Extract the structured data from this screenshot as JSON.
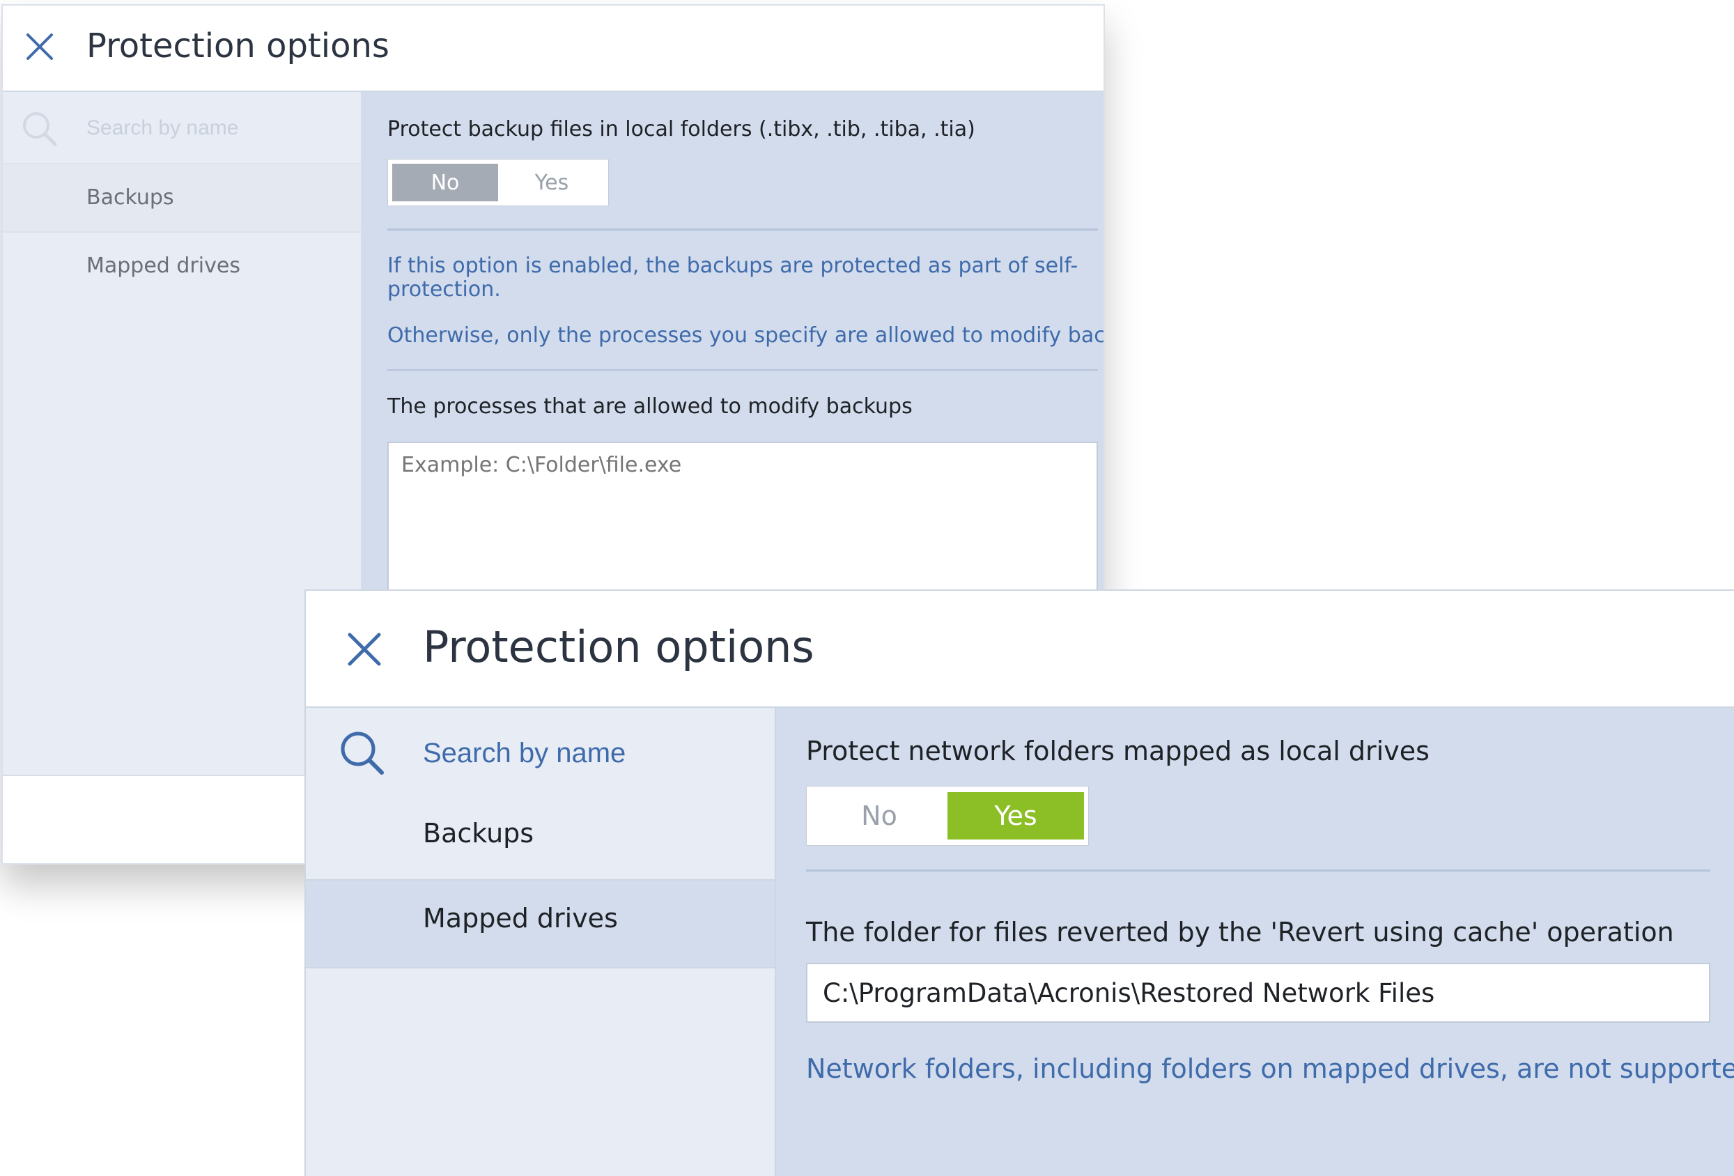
{
  "dialog_back": {
    "title": "Protection options",
    "search": {
      "placeholder": "Search by name"
    },
    "nav": {
      "backups": "Backups",
      "mapped_drives": "Mapped drives"
    },
    "content": {
      "option_label": "Protect backup files in local folders (.tibx, .tib, .tiba, .tia)",
      "toggle": {
        "no": "No",
        "yes": "Yes",
        "selected": "No"
      },
      "info_line1": "If this option is enabled, the backups are protected as part of self-",
      "info_line2": "protection.",
      "info_line3": "Otherwise, only the processes you specify are allowed to modify backups.",
      "processes_label": "The processes that are allowed to modify backups",
      "processes_placeholder": "Example: C:\\Folder\\file.exe"
    }
  },
  "dialog_front": {
    "title": "Protection options",
    "search": {
      "placeholder": "Search by name"
    },
    "nav": {
      "backups": "Backups",
      "mapped_drives": "Mapped drives",
      "selected": "Mapped drives"
    },
    "content": {
      "option_label": "Protect network folders mapped as local drives",
      "toggle": {
        "no": "No",
        "yes": "Yes",
        "selected": "Yes"
      },
      "folder_label": "The folder for files reverted by the 'Revert using cache' operation",
      "folder_value": "C:\\ProgramData\\Acronis\\Restored Network Files",
      "note": "Network folders, including folders on mapped drives, are not supported."
    }
  },
  "colors": {
    "accent_blue": "#3f6bab",
    "toggle_yes_green": "#8cbf26",
    "toggle_no_gray": "#a5abb4",
    "content_bg": "#d2dcec",
    "sidebar_bg": "#e7ecf5"
  },
  "icons": [
    "close-icon",
    "search-icon"
  ]
}
